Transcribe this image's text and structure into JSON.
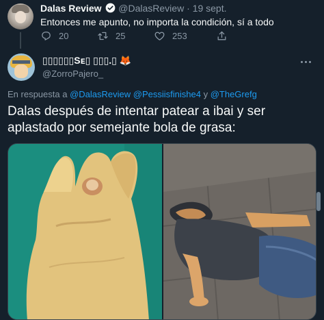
{
  "parent_tweet": {
    "display_name": "Dalas Review",
    "handle": "@DalasReview",
    "separator": "·",
    "date": "19 sept.",
    "text": "Entonces me apunto, no importa la condición, sí a todo",
    "reply_count": "20",
    "retweet_count": "25",
    "like_count": "253"
  },
  "reply_tweet": {
    "display_name": "▯▯▯▯▯▯Sᴇ▯ ▯▯▯.▯ 🦊",
    "handle": "@ZorroPajero_",
    "replying_prefix": "En respuesta a",
    "mentions": [
      "@DalasReview",
      "@Pessiisfinishe4",
      "@TheGrefg"
    ],
    "mention_joiner": "y",
    "text": "Dalas después de intentar patear a ibai y ser aplastado por semejante bola de grasa:"
  },
  "colors": {
    "background": "#15202b",
    "text": "#f7f9f9",
    "muted": "#8b98a5",
    "accent": "#1d9bf0"
  },
  "icons": {
    "reply": "reply-icon",
    "retweet": "retweet-icon",
    "like": "heart-icon",
    "share": "share-icon",
    "verified": "verified-badge-icon",
    "more": "more-options-icon"
  }
}
